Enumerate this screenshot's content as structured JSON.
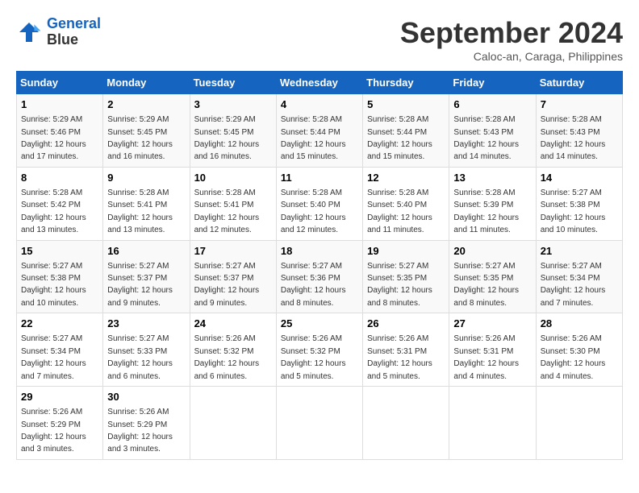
{
  "header": {
    "logo_line1": "General",
    "logo_line2": "Blue",
    "month": "September 2024",
    "location": "Caloc-an, Caraga, Philippines"
  },
  "columns": [
    "Sunday",
    "Monday",
    "Tuesday",
    "Wednesday",
    "Thursday",
    "Friday",
    "Saturday"
  ],
  "weeks": [
    [
      {
        "day": "1",
        "sunrise": "5:29 AM",
        "sunset": "5:46 PM",
        "daylight": "12 hours and 17 minutes."
      },
      {
        "day": "2",
        "sunrise": "5:29 AM",
        "sunset": "5:45 PM",
        "daylight": "12 hours and 16 minutes."
      },
      {
        "day": "3",
        "sunrise": "5:29 AM",
        "sunset": "5:45 PM",
        "daylight": "12 hours and 16 minutes."
      },
      {
        "day": "4",
        "sunrise": "5:28 AM",
        "sunset": "5:44 PM",
        "daylight": "12 hours and 15 minutes."
      },
      {
        "day": "5",
        "sunrise": "5:28 AM",
        "sunset": "5:44 PM",
        "daylight": "12 hours and 15 minutes."
      },
      {
        "day": "6",
        "sunrise": "5:28 AM",
        "sunset": "5:43 PM",
        "daylight": "12 hours and 14 minutes."
      },
      {
        "day": "7",
        "sunrise": "5:28 AM",
        "sunset": "5:43 PM",
        "daylight": "12 hours and 14 minutes."
      }
    ],
    [
      {
        "day": "8",
        "sunrise": "5:28 AM",
        "sunset": "5:42 PM",
        "daylight": "12 hours and 13 minutes."
      },
      {
        "day": "9",
        "sunrise": "5:28 AM",
        "sunset": "5:41 PM",
        "daylight": "12 hours and 13 minutes."
      },
      {
        "day": "10",
        "sunrise": "5:28 AM",
        "sunset": "5:41 PM",
        "daylight": "12 hours and 12 minutes."
      },
      {
        "day": "11",
        "sunrise": "5:28 AM",
        "sunset": "5:40 PM",
        "daylight": "12 hours and 12 minutes."
      },
      {
        "day": "12",
        "sunrise": "5:28 AM",
        "sunset": "5:40 PM",
        "daylight": "12 hours and 11 minutes."
      },
      {
        "day": "13",
        "sunrise": "5:28 AM",
        "sunset": "5:39 PM",
        "daylight": "12 hours and 11 minutes."
      },
      {
        "day": "14",
        "sunrise": "5:27 AM",
        "sunset": "5:38 PM",
        "daylight": "12 hours and 10 minutes."
      }
    ],
    [
      {
        "day": "15",
        "sunrise": "5:27 AM",
        "sunset": "5:38 PM",
        "daylight": "12 hours and 10 minutes."
      },
      {
        "day": "16",
        "sunrise": "5:27 AM",
        "sunset": "5:37 PM",
        "daylight": "12 hours and 9 minutes."
      },
      {
        "day": "17",
        "sunrise": "5:27 AM",
        "sunset": "5:37 PM",
        "daylight": "12 hours and 9 minutes."
      },
      {
        "day": "18",
        "sunrise": "5:27 AM",
        "sunset": "5:36 PM",
        "daylight": "12 hours and 8 minutes."
      },
      {
        "day": "19",
        "sunrise": "5:27 AM",
        "sunset": "5:35 PM",
        "daylight": "12 hours and 8 minutes."
      },
      {
        "day": "20",
        "sunrise": "5:27 AM",
        "sunset": "5:35 PM",
        "daylight": "12 hours and 8 minutes."
      },
      {
        "day": "21",
        "sunrise": "5:27 AM",
        "sunset": "5:34 PM",
        "daylight": "12 hours and 7 minutes."
      }
    ],
    [
      {
        "day": "22",
        "sunrise": "5:27 AM",
        "sunset": "5:34 PM",
        "daylight": "12 hours and 7 minutes."
      },
      {
        "day": "23",
        "sunrise": "5:27 AM",
        "sunset": "5:33 PM",
        "daylight": "12 hours and 6 minutes."
      },
      {
        "day": "24",
        "sunrise": "5:26 AM",
        "sunset": "5:32 PM",
        "daylight": "12 hours and 6 minutes."
      },
      {
        "day": "25",
        "sunrise": "5:26 AM",
        "sunset": "5:32 PM",
        "daylight": "12 hours and 5 minutes."
      },
      {
        "day": "26",
        "sunrise": "5:26 AM",
        "sunset": "5:31 PM",
        "daylight": "12 hours and 5 minutes."
      },
      {
        "day": "27",
        "sunrise": "5:26 AM",
        "sunset": "5:31 PM",
        "daylight": "12 hours and 4 minutes."
      },
      {
        "day": "28",
        "sunrise": "5:26 AM",
        "sunset": "5:30 PM",
        "daylight": "12 hours and 4 minutes."
      }
    ],
    [
      {
        "day": "29",
        "sunrise": "5:26 AM",
        "sunset": "5:29 PM",
        "daylight": "12 hours and 3 minutes."
      },
      {
        "day": "30",
        "sunrise": "5:26 AM",
        "sunset": "5:29 PM",
        "daylight": "12 hours and 3 minutes."
      },
      null,
      null,
      null,
      null,
      null
    ]
  ]
}
